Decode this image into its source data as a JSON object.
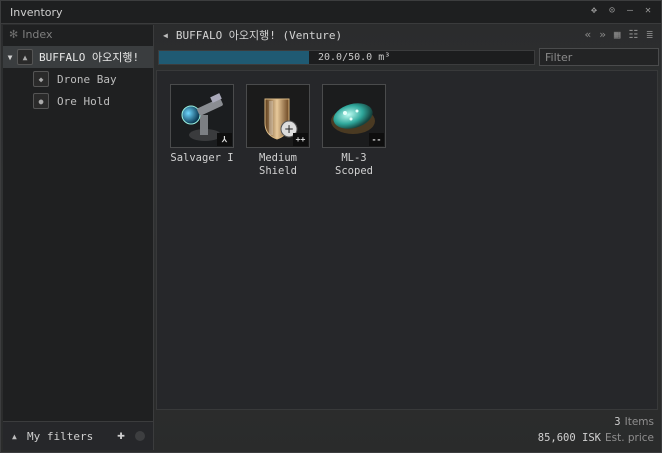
{
  "window": {
    "title": "Inventory"
  },
  "titlebar_icons": [
    "pin-icon",
    "settings-icon",
    "minimize-icon",
    "close-icon"
  ],
  "sidebar": {
    "index_label": "Index",
    "tree": [
      {
        "label": "BUFFALO 아오지행!",
        "icon": "ship-icon",
        "selected": true
      },
      {
        "label": "Drone Bay",
        "icon": "drone-bay-icon"
      },
      {
        "label": "Ore Hold",
        "icon": "ore-hold-icon"
      }
    ],
    "filters_label": "My filters"
  },
  "main": {
    "location": "BUFFALO 아오지행! (Venture)",
    "capacity_text": "20.0/50.0 m³",
    "capacity_fraction": 0.4,
    "filter_placeholder": "Filter",
    "items": [
      {
        "name_line1": "Salvager I",
        "name_line2": "",
        "badge": "⅄"
      },
      {
        "name_line1": "Medium",
        "name_line2": "Shield",
        "badge": "++"
      },
      {
        "name_line1": "ML-3",
        "name_line2": "Scoped",
        "badge": "--"
      }
    ],
    "item_count": "3",
    "item_count_unit": "Items",
    "est_price": "85,600 ISK",
    "est_price_unit": "Est. price"
  },
  "colors": {
    "capacity_fill": "#1f5a73",
    "background": "#2b2c2d"
  }
}
